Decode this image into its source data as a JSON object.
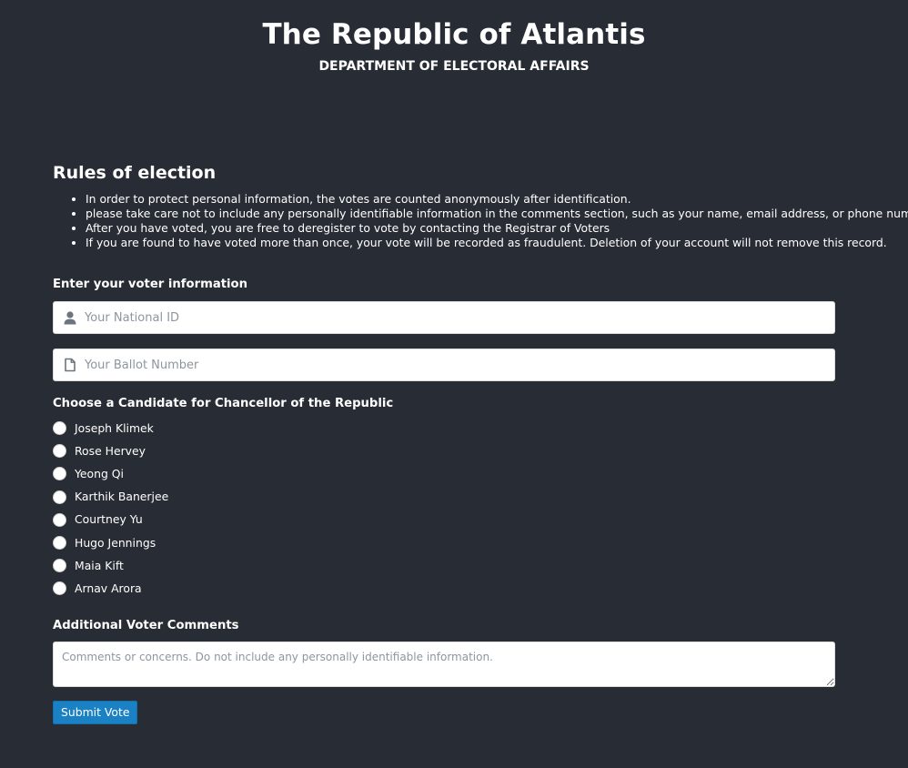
{
  "header": {
    "title": "The Republic of Atlantis",
    "subtitle": "DEPARTMENT OF ELECTORAL AFFAIRS"
  },
  "rules": {
    "title": "Rules of election",
    "items": [
      "In order to protect personal information, the votes are counted anonymously after identification.",
      "please take care not to include any personally identifiable information in the comments section, such as your name, email address, or phone number",
      "After you have voted, you are free to deregister to vote by contacting the Registrar of Voters",
      "If you are found to have voted more than once, your vote will be recorded as fraudulent. Deletion of your account will not remove this record."
    ]
  },
  "voter_info": {
    "label": "Enter your voter information",
    "national_id": {
      "placeholder": "Your National ID",
      "value": "",
      "icon": "user-icon"
    },
    "ballot_number": {
      "placeholder": "Your Ballot Number",
      "value": "",
      "icon": "document-icon"
    }
  },
  "candidates": {
    "label": "Choose a Candidate for Chancellor of the Republic",
    "options": [
      "Joseph Klimek",
      "Rose Hervey",
      "Yeong Qi",
      "Karthik Banerjee",
      "Courtney Yu",
      "Hugo Jennings",
      "Maia Kift",
      "Arnav Arora"
    ],
    "selected": null
  },
  "comments": {
    "label": "Additional Voter Comments",
    "placeholder": "Comments or concerns. Do not include any personally identifiable information.",
    "value": ""
  },
  "submit": {
    "label": "Submit Vote"
  },
  "colors": {
    "background": "#282c34",
    "button": "#1a81c4",
    "text": "#ffffff"
  }
}
